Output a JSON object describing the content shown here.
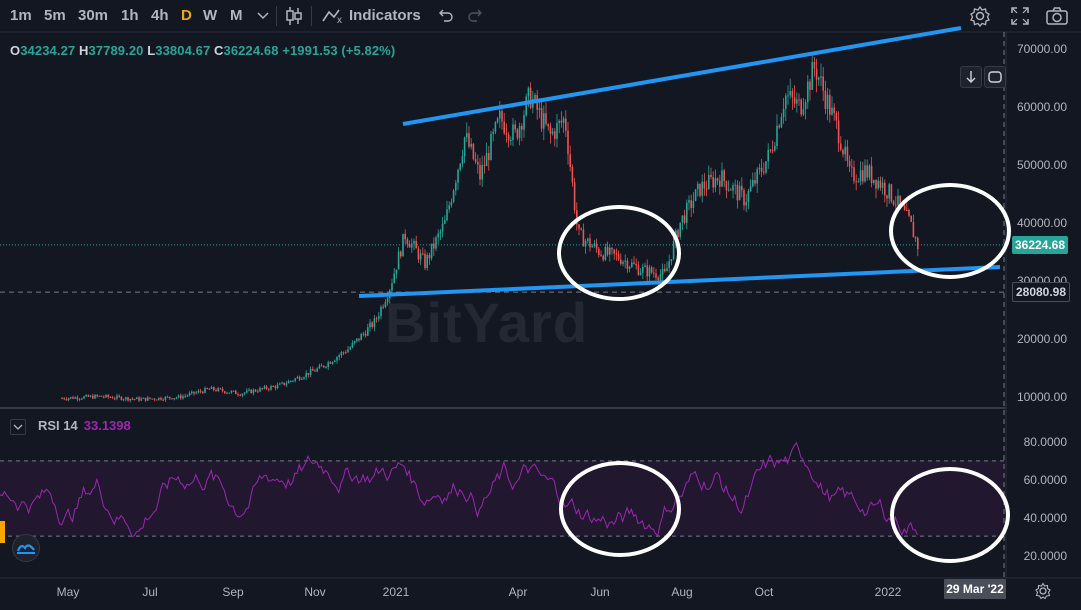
{
  "toolbar": {
    "timeframes": [
      "1m",
      "5m",
      "30m",
      "1h",
      "4h",
      "D",
      "W",
      "M"
    ],
    "active_timeframe": "D",
    "indicators_label": "Indicators"
  },
  "ohlc": {
    "o_label": "O",
    "o_value": "34234.27",
    "h_label": "H",
    "h_value": "37789.20",
    "l_label": "L",
    "l_value": "33804.67",
    "c_label": "C",
    "c_value": "36224.68",
    "change": "+1991.53 (+5.82%)"
  },
  "price_axis": {
    "ticks": [
      "70000.00",
      "60000.00",
      "50000.00",
      "40000.00",
      "30000.00",
      "20000.00",
      "10000.00"
    ],
    "current_price": "36224.68",
    "crosshair_price": "28080.98"
  },
  "rsi": {
    "label": "RSI 14",
    "value": "33.1398",
    "ticks": [
      "80.0000",
      "60.0000",
      "40.0000",
      "20.0000"
    ]
  },
  "time_axis": {
    "ticks": [
      "May",
      "Jul",
      "Sep",
      "Nov",
      "2021",
      "Apr",
      "Jun",
      "Aug",
      "Oct",
      "2022"
    ],
    "crosshair_date": "29 Mar '22"
  },
  "watermark": "BitYard",
  "colors": {
    "background": "#131722",
    "up": "#26a69a",
    "down": "#ef5350",
    "trendline": "#2196f3",
    "rsi_line": "#9c27b0",
    "active_timeframe": "#f7a600"
  }
}
